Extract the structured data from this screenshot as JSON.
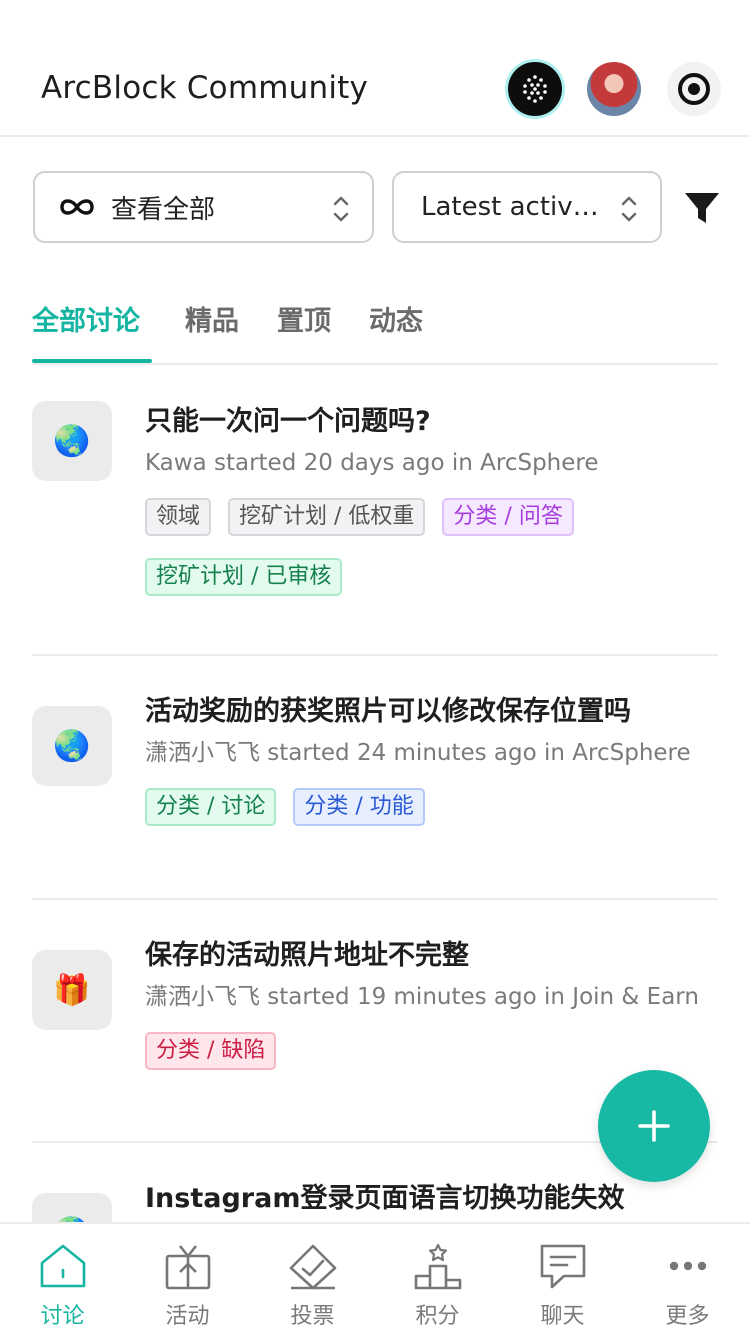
{
  "header": {
    "title": "ArcBlock Community",
    "icons": [
      "blocklet-logo-icon",
      "user-avatar",
      "record-icon"
    ]
  },
  "filters": {
    "scope_label": "查看全部",
    "sort_label": "Latest activity"
  },
  "tabs": [
    {
      "label": "全部讨论",
      "active": true
    },
    {
      "label": "精品",
      "active": false
    },
    {
      "label": "置顶",
      "active": false
    },
    {
      "label": "动态",
      "active": false
    }
  ],
  "posts": [
    {
      "icon": "🌏",
      "title": "只能一次问一个问题吗?",
      "meta": "Kawa started 20 days ago in ArcSphere",
      "tags": [
        {
          "label": "领域",
          "color": "gray"
        },
        {
          "label": "挖矿计划 / 低权重",
          "color": "gray"
        },
        {
          "label": "分类 / 问答",
          "color": "purple"
        },
        {
          "label": "挖矿计划 / 已审核",
          "color": "green"
        }
      ]
    },
    {
      "icon": "🌏",
      "title": "活动奖励的获奖照片可以修改保存位置吗",
      "meta": "潇洒小飞飞 started 24 minutes ago in ArcSphere",
      "tags": [
        {
          "label": "分类 / 讨论",
          "color": "green"
        },
        {
          "label": "分类 / 功能",
          "color": "blue"
        }
      ]
    },
    {
      "icon": "🎁",
      "title": "保存的活动照片地址不完整",
      "meta": "潇洒小飞飞 started 19 minutes ago in Join & Earn",
      "tags": [
        {
          "label": "分类 / 缺陷",
          "color": "red"
        }
      ]
    },
    {
      "icon": "🌏",
      "title": "Instagram登录页面语言切换功能失效",
      "meta": "",
      "tags": []
    }
  ],
  "nav": [
    {
      "label": "讨论",
      "icon": "home-icon",
      "active": true
    },
    {
      "label": "活动",
      "icon": "gift-icon",
      "active": false
    },
    {
      "label": "投票",
      "icon": "vote-icon",
      "active": false
    },
    {
      "label": "积分",
      "icon": "podium-icon",
      "active": false
    },
    {
      "label": "聊天",
      "icon": "chat-icon",
      "active": false
    },
    {
      "label": "更多",
      "icon": "more-icon",
      "active": false
    }
  ],
  "colors": {
    "accent": "#16b5a2",
    "fab": "#17b9a5"
  }
}
